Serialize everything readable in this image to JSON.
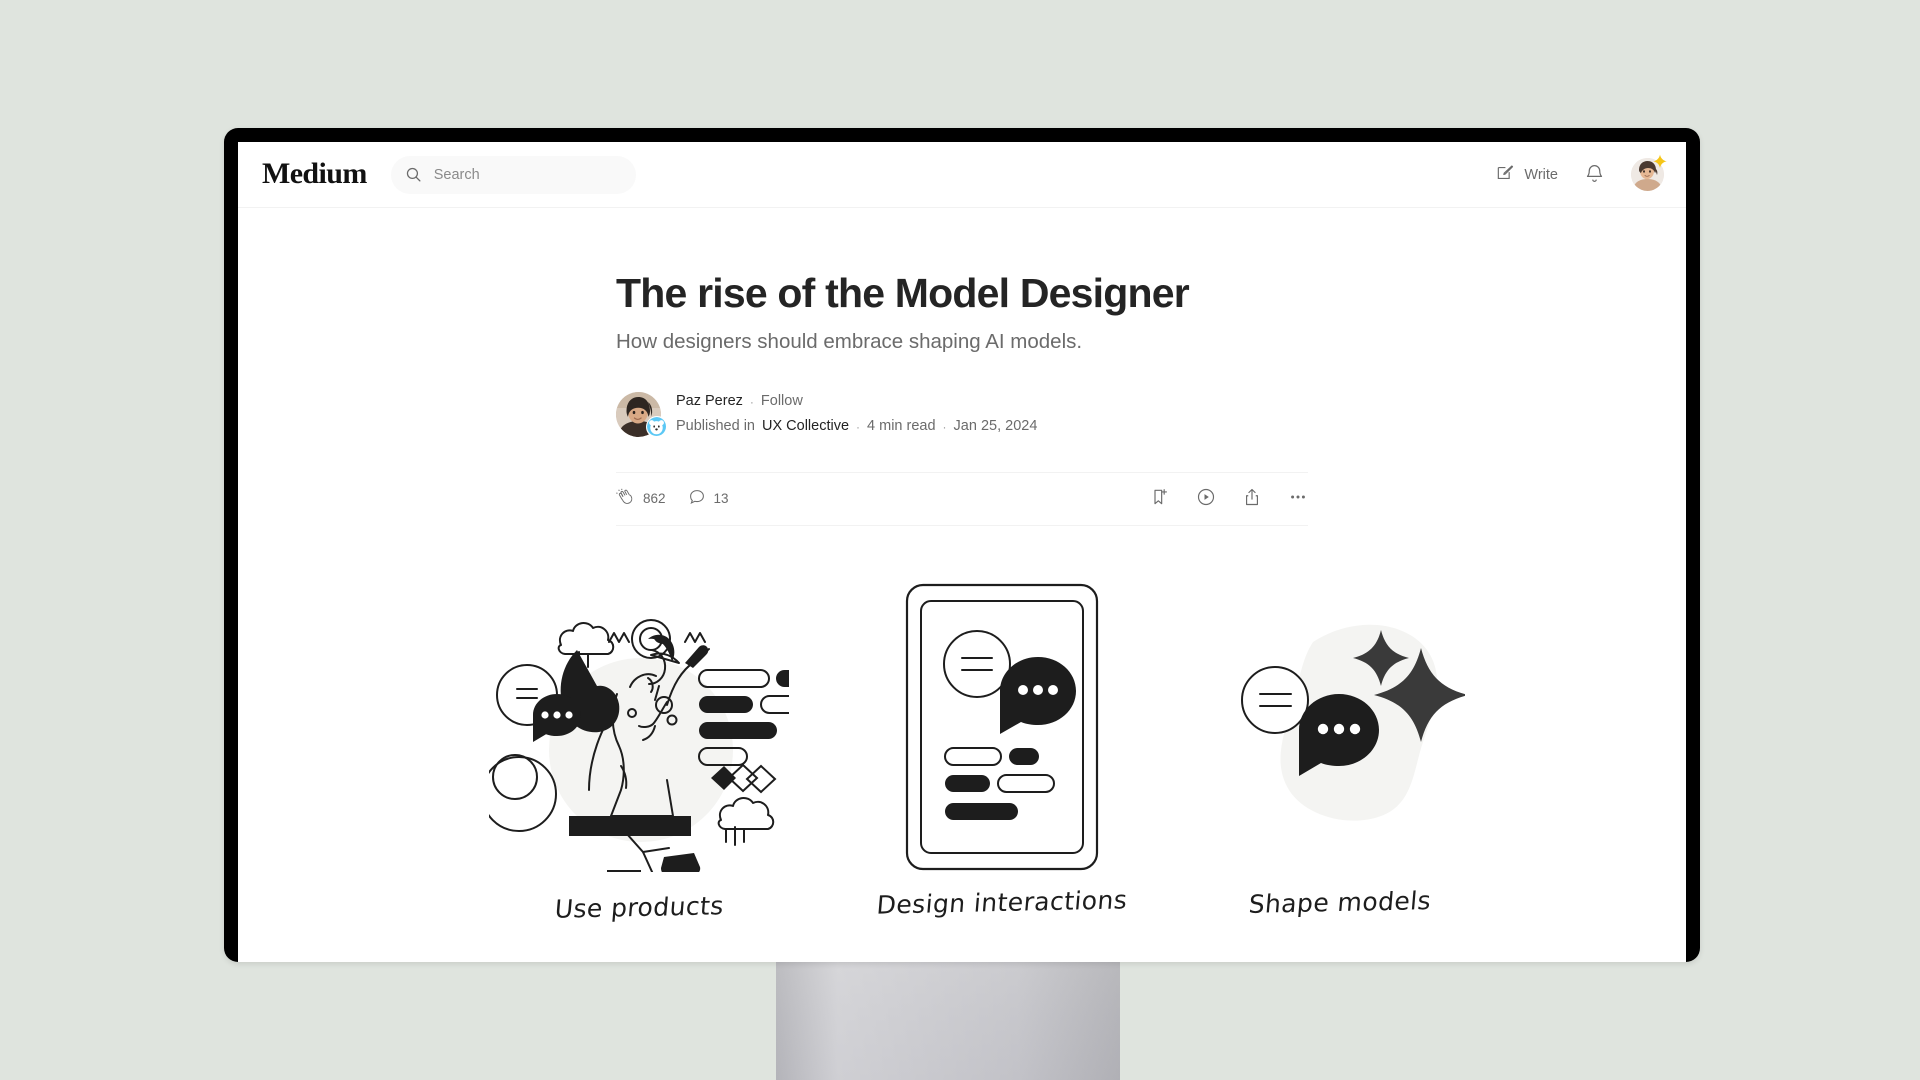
{
  "theme": {
    "page_background": "#dfe4de",
    "bezel_color": "#000000",
    "stand_color": "#c4c4c9",
    "text_primary": "#242424",
    "text_secondary": "#6b6b6b",
    "accent_sparkle": "#f5c518"
  },
  "header": {
    "logo": "Medium",
    "search": {
      "placeholder": "Search",
      "value": "",
      "icon": "search-icon"
    },
    "write": {
      "label": "Write",
      "icon": "write-pencil-icon"
    },
    "notifications": {
      "icon": "bell-icon"
    },
    "avatar": {
      "icon": "user-avatar",
      "badge_icon": "sparkle-icon"
    }
  },
  "article": {
    "title": "The rise of the Model Designer",
    "subtitle": "How designers should embrace shaping AI models.",
    "byline": {
      "author": "Paz Perez",
      "separator": "·",
      "follow_label": "Follow",
      "published_in_prefix": "Published in",
      "publication": "UX Collective",
      "read_time": "4 min read",
      "date": "Jan 25, 2024",
      "avatar_icon": "author-avatar",
      "publication_badge_icon": "ux-collective-bear-icon"
    },
    "stats": {
      "claps": "862",
      "claps_icon": "clap-icon",
      "responses": "13",
      "responses_icon": "comment-icon"
    },
    "actions": [
      {
        "name": "save-button",
        "icon": "bookmark-plus-icon"
      },
      {
        "name": "listen-button",
        "icon": "play-circle-icon"
      },
      {
        "name": "share-button",
        "icon": "share-icon"
      },
      {
        "name": "more-options-button",
        "icon": "ellipsis-icon"
      }
    ],
    "illustrations": [
      {
        "caption": "Use products",
        "icon": "person-using-product-illustration"
      },
      {
        "caption": "Design interactions",
        "icon": "phone-chat-illustration"
      },
      {
        "caption": "Shape models",
        "icon": "ai-sparkle-chat-illustration"
      }
    ]
  }
}
